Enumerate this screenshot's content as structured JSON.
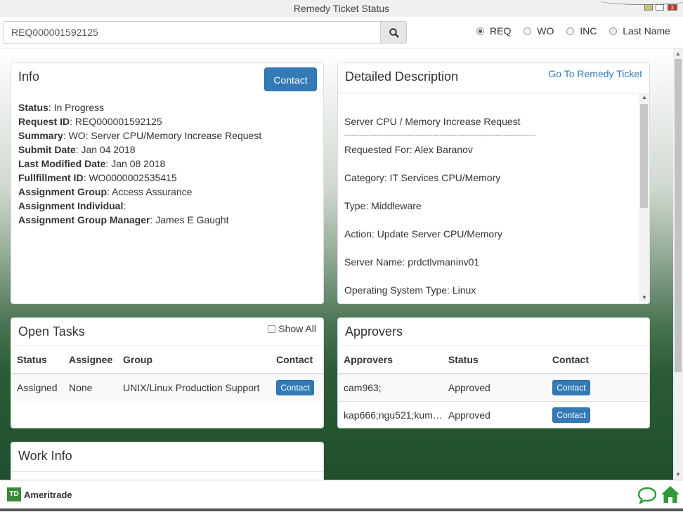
{
  "window": {
    "title": "Remedy Ticket Status"
  },
  "search": {
    "value": "REQ000001592125",
    "options": [
      {
        "label": "REQ",
        "selected": true
      },
      {
        "label": "WO",
        "selected": false
      },
      {
        "label": "INC",
        "selected": false
      },
      {
        "label": "Last Name",
        "selected": false
      }
    ]
  },
  "info": {
    "title": "Info",
    "contact_label": "Contact",
    "fields": [
      {
        "label": "Status",
        "value": ": In Progress"
      },
      {
        "label": "Request ID",
        "value": ": REQ000001592125"
      },
      {
        "label": "Summary",
        "value": ": WO: Server CPU/Memory Increase Request"
      },
      {
        "label": "Submit Date",
        "value": ": Jan 04 2018"
      },
      {
        "label": "Last Modified Date",
        "value": ": Jan 08 2018"
      },
      {
        "label": "Fullfillment ID",
        "value": ": WO0000002535415"
      },
      {
        "label": "Assignment Group",
        "value": ": Access Assurance"
      },
      {
        "label": "Assignment Individual",
        "value": ":"
      },
      {
        "label": "Assignment Group Manager",
        "value": ": James E Gaught"
      }
    ]
  },
  "description": {
    "title": "Detailed Description",
    "link": "Go To Remedy Ticket",
    "heading": "Server CPU / Memory Increase Request",
    "rule": "------------------------------------------------------------------------------------------------------",
    "lines": [
      "Requested For: Alex Baranov",
      "Category: IT Services CPU/Memory",
      "Type: Middleware",
      "Action: Update Server CPU/Memory",
      "Server Name: prdctlvmaninv01",
      "Operating System Type: Linux"
    ]
  },
  "tasks": {
    "title": "Open Tasks",
    "show_all_label": "Show All",
    "columns": [
      "Status",
      "Assignee",
      "Group",
      "Contact"
    ],
    "rows": [
      {
        "status": "Assigned",
        "assignee": "None",
        "group": "UNIX/Linux Production Support",
        "contact": "Contact"
      }
    ]
  },
  "approvers": {
    "title": "Approvers",
    "columns": [
      "Approvers",
      "Status",
      "Contact"
    ],
    "rows": [
      {
        "approvers": "cam963;",
        "status": "Approved",
        "contact": "Contact"
      },
      {
        "approvers": "kap666;ngu521;kum…",
        "status": "Approved",
        "contact": "Contact"
      }
    ]
  },
  "work_info": {
    "title": "Work Info"
  },
  "footer": {
    "logo_mark": "TD",
    "logo_name": "Ameritrade"
  },
  "colors": {
    "primary": "#337ab7",
    "brand_green": "#3b8a3b",
    "background_dark_green": "#1f4f2c"
  }
}
